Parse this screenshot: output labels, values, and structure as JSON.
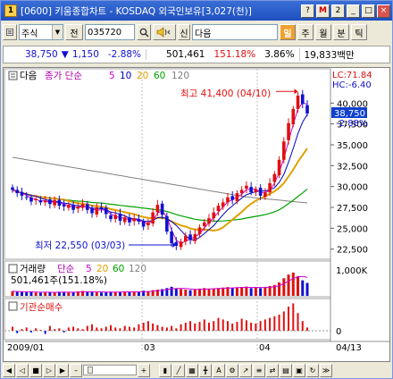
{
  "window": {
    "icon_label": "1",
    "title": "[0600] 키움종합차트 - KOSDAQ 외국인보유[3,027(천)]",
    "btn_help": "?",
    "btn_mark": "M",
    "btn_2": "2",
    "btn_min": "_",
    "btn_max": "□",
    "btn_close": "×"
  },
  "toolbar": {
    "type_value": "주식",
    "type_extra": "전",
    "code_value": "035720",
    "stock_name": "다음",
    "name_prefix": "신",
    "period_day": "일",
    "period_week": "주",
    "period_month": "월",
    "period_minute": "분",
    "period_tick": "틱"
  },
  "price": {
    "current": "38,750",
    "arrow": "▼",
    "change": "1,150",
    "change_pct": "-2.88%",
    "volume": "501,461",
    "vol_ratio": "151.18%",
    "turnover": "3.86%",
    "amount": "19,833백만"
  },
  "colors": {
    "up": "#e01010",
    "down": "#1010d0",
    "ma5": "#d000d0",
    "ma10": "#0000c0",
    "ma20": "#e0a000",
    "ma60": "#00a000",
    "ma120": "#808080",
    "background": "#ffffff",
    "accent": "#f0a030"
  },
  "price_panel": {
    "name_label": "다음",
    "indicator_label": "종가 단순",
    "periods": [
      "5",
      "10",
      "20",
      "60",
      "120"
    ],
    "lc": "LC:71.84",
    "hc": "HC:-6.40",
    "high_label": "최고 41,400 (04/10)",
    "low_label": "최저 22,550 (03/03)",
    "current_tag": "38,750",
    "current_pct": "-2.88%",
    "y_ticks": [
      "40,000",
      "37,500",
      "35,000",
      "32,500",
      "30,000",
      "27,500",
      "25,000",
      "22,500"
    ]
  },
  "volume_panel": {
    "label": "거래량",
    "indicator_label": "단순",
    "periods": [
      "5",
      "20",
      "60",
      "120"
    ],
    "value_text": "501,461주(151.18%)",
    "y_tick": "1,000K"
  },
  "inst_panel": {
    "label": "기관순매수",
    "y_tick": "0"
  },
  "x_axis": {
    "labels": [
      "2009/01",
      "03",
      "04",
      "04/13"
    ]
  },
  "chart_data": {
    "type": "candlestick",
    "period": "daily",
    "x_labels": [
      "2009/01",
      "03",
      "04",
      "04/13"
    ],
    "ylim": [
      21500,
      42500
    ],
    "high": {
      "value": 41400,
      "date": "04/10"
    },
    "low": {
      "value": 22550,
      "date": "03/03"
    },
    "close": [
      29600,
      29200,
      28900,
      28700,
      28200,
      28500,
      28100,
      28300,
      27900,
      28400,
      27700,
      27600,
      27800,
      27200,
      27600,
      27900,
      27200,
      26800,
      27500,
      27300,
      26700,
      26100,
      26600,
      25900,
      26300,
      25700,
      26200,
      25800,
      25200,
      25700,
      26900,
      27800,
      26600,
      24600,
      23200,
      22900,
      23400,
      24100,
      23600,
      24300,
      25100,
      25700,
      26200,
      26900,
      27700,
      28100,
      28700,
      28400,
      29200,
      29600,
      30100,
      29300,
      29700,
      28900,
      29300,
      30400,
      31500,
      33200,
      35400,
      37600,
      39300,
      40900,
      39900,
      38750
    ],
    "volume": [
      180,
      160,
      150,
      140,
      170,
      130,
      120,
      140,
      150,
      130,
      160,
      140,
      130,
      150,
      170,
      190,
      160,
      150,
      140,
      130,
      150,
      160,
      140,
      150,
      170,
      160,
      150,
      140,
      200,
      180,
      220,
      240,
      260,
      300,
      350,
      280,
      260,
      240,
      220,
      260,
      280,
      300,
      260,
      280,
      300,
      320,
      340,
      300,
      320,
      340,
      360,
      300,
      320,
      300,
      340,
      380,
      420,
      520,
      680,
      820,
      900,
      760,
      600,
      501
    ],
    "inst_net": [
      5,
      -3,
      2,
      4,
      -2,
      3,
      1,
      -4,
      6,
      2,
      3,
      -2,
      4,
      5,
      3,
      2,
      6,
      8,
      4,
      3,
      5,
      7,
      4,
      3,
      6,
      5,
      4,
      8,
      10,
      12,
      9,
      7,
      5,
      4,
      6,
      3,
      8,
      10,
      12,
      9,
      11,
      14,
      10,
      12,
      16,
      14,
      12,
      9,
      11,
      15,
      13,
      10,
      9,
      12,
      14,
      16,
      18,
      20,
      24,
      30,
      34,
      22,
      12,
      4
    ]
  }
}
